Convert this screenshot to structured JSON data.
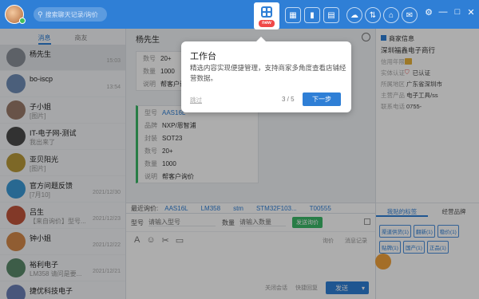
{
  "topbar": {
    "search_placeholder": "搜索聊天记录/询价",
    "workbench_badge": "new",
    "tool_icons": [
      "apps-icon",
      "chart-icon",
      "cart-icon"
    ],
    "right_icons": [
      "cloud-icon",
      "sync-icon",
      "store-icon",
      "envelope-icon"
    ],
    "window_controls": [
      "settings-icon",
      "minimize-icon",
      "maximize-icon",
      "close-icon"
    ],
    "brand_color": "#2f7fd6"
  },
  "left": {
    "tabs": [
      {
        "label": "消息"
      },
      {
        "label": "商友"
      }
    ],
    "contacts": [
      {
        "name": "杨先生",
        "msg": "",
        "time": "15:03",
        "color": "#8a8f99"
      },
      {
        "name": "bo-iscp",
        "msg": "",
        "time": "13:54",
        "color": "#6f8db5"
      },
      {
        "name": "子小姐",
        "msg": "[图片]",
        "time": "",
        "color": "#9a7b6a"
      },
      {
        "name": "IT-电子网-测试",
        "msg": "我出来了",
        "time": "",
        "color": "#4a4a4a"
      },
      {
        "name": "亚贝阳光",
        "msg": "[图片]",
        "time": "",
        "color": "#b99a3a"
      },
      {
        "name": "官方问题反馈",
        "msg": "[7月10]",
        "time": "2021/12/30",
        "color": "#3b9ad6"
      },
      {
        "name": "吕生",
        "msg": "【来自询价】型号...",
        "time": "2021/12/23",
        "color": "#c0543b"
      },
      {
        "name": "钟小姐",
        "msg": "",
        "time": "2021/12/22",
        "color": "#d48a4a"
      },
      {
        "name": "裕利电子",
        "msg": "LM358 请问是要...",
        "time": "2021/12/21",
        "color": "#5a8a6a"
      },
      {
        "name": "捷优科技电子",
        "msg": "",
        "time": "",
        "color": "#6a7fb5"
      }
    ]
  },
  "chat": {
    "contact_name": "杨先生",
    "card1": {
      "rows": [
        {
          "k": "数号",
          "v": "20+"
        },
        {
          "k": "数量",
          "v": "1000"
        },
        {
          "k": "说明",
          "v": "帮客户询价"
        }
      ]
    },
    "card2": {
      "rows": [
        {
          "k": "型号",
          "v": "AAS16L",
          "link": true
        },
        {
          "k": "品牌",
          "v": "NXP/恩智浦"
        },
        {
          "k": "封装",
          "v": "SOT23"
        },
        {
          "k": "数号",
          "v": "20+"
        },
        {
          "k": "数量",
          "v": "1000"
        },
        {
          "k": "说明",
          "v": "帮客户询价"
        }
      ]
    },
    "recent_label": "最近询价:",
    "recent_chips": [
      "AAS16L",
      "LM358",
      "stm",
      "STM32F103...",
      "T00555"
    ],
    "model_label": "型号",
    "model_placeholder": "请输入型号",
    "qty_label": "数量",
    "qty_placeholder": "请输入数量",
    "send_inquiry": "发送询价",
    "toolbar_icons": [
      "font-icon",
      "emoji-icon",
      "scissors-icon",
      "folder-icon"
    ],
    "links": [
      "询价",
      "消息记录"
    ],
    "close_label": "关闭会话",
    "quick_reply": "快捷回复",
    "send_label": "发送"
  },
  "right": {
    "header": "商家信息",
    "company": "深圳福鑫电子商行",
    "rows": [
      {
        "k": "信用年限",
        "v": ""
      },
      {
        "k": "实体认证",
        "v": "已认证"
      },
      {
        "k": "所属地区",
        "v": "广东省深圳市"
      },
      {
        "k": "主营产品",
        "v": "电子工具/ss"
      },
      {
        "k": "联系电话",
        "v": "0755-"
      }
    ],
    "tabs": [
      "我贴的标签",
      "经营品牌"
    ],
    "tags": [
      "渠道供货(1)",
      "翻新(1)",
      "稳价(1)",
      "贴牌(1)",
      "国产(1)",
      "正品(1)"
    ]
  },
  "tour": {
    "title": "工作台",
    "desc": "精选内容实现便捷管理，支持商家多角度查看店铺经营数据。",
    "skip": "跳过",
    "pager": "3 / 5",
    "next": "下一步"
  }
}
